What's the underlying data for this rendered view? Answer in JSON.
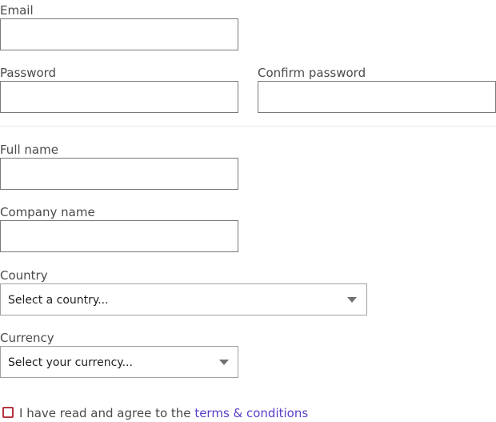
{
  "form": {
    "email": {
      "label": "Email",
      "value": ""
    },
    "password": {
      "label": "Password",
      "value": ""
    },
    "confirm_password": {
      "label": "Confirm password",
      "value": ""
    },
    "full_name": {
      "label": "Full name",
      "value": ""
    },
    "company_name": {
      "label": "Company name",
      "value": ""
    },
    "country": {
      "label": "Country",
      "selected": "Select a country..."
    },
    "currency": {
      "label": "Currency",
      "selected": "Select your currency..."
    },
    "terms": {
      "text": "I have read and agree to the",
      "link_text": "terms & conditions",
      "checked": false
    }
  },
  "icons": {
    "dropdown": "chevron-down-icon",
    "checkbox": "checkbox-unchecked-icon"
  },
  "colors": {
    "link": "#5a3ec8",
    "checkbox_border": "#b4343f",
    "input_border": "#7a7a7a",
    "label_text": "#4a4a4a"
  }
}
